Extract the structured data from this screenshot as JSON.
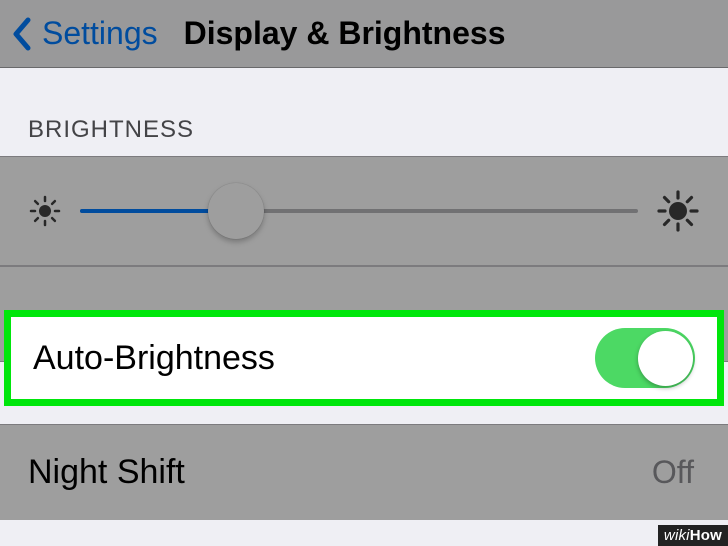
{
  "nav": {
    "back_label": "Settings",
    "title": "Display & Brightness"
  },
  "brightness": {
    "section_header": "BRIGHTNESS",
    "slider_percent": 28
  },
  "auto_brightness": {
    "label": "Auto-Brightness",
    "enabled": true
  },
  "night_shift": {
    "label": "Night Shift",
    "value": "Off"
  },
  "colors": {
    "tint": "#007aff",
    "toggle_on": "#4cd964",
    "highlight_border": "#00e60b"
  },
  "watermark": {
    "line1": "wiki",
    "line2": "How"
  }
}
